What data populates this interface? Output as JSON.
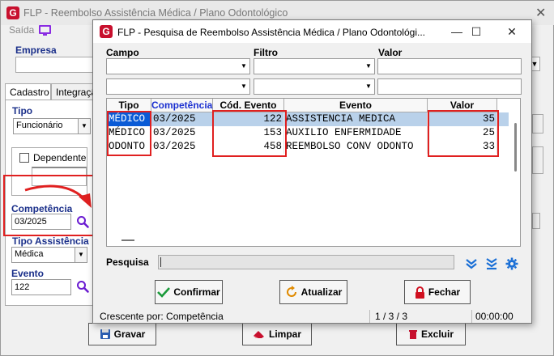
{
  "main": {
    "title": "FLP - Reembolso Assistência Médica / Plano Odontológico",
    "close": "✕",
    "saida": "Saída",
    "empresa_label": "Empresa",
    "tabs": [
      {
        "label": "Cadastro"
      },
      {
        "label": "Integração"
      }
    ],
    "tipo_label": "Tipo",
    "tipo_value": "Funcionário",
    "dependente_label": "Dependente",
    "competencia_label": "Competência",
    "competencia_value": "03/2025",
    "tipo_assistencia_label": "Tipo Assistência",
    "tipo_assistencia_value": "Médica",
    "evento_label": "Evento",
    "evento_value": "122",
    "gravar": "Gravar",
    "limpar": "Limpar",
    "excluir": "Excluir"
  },
  "dialog": {
    "title": "FLP - Pesquisa de Reembolso Assistência Médica / Plano Odontológi...",
    "campo_label": "Campo",
    "filtro_label": "Filtro",
    "valor_label": "Valor",
    "columns": [
      "Tipo",
      "Competência",
      "Cód. Evento",
      "Evento",
      "Valor"
    ],
    "rows": [
      {
        "tipo": "MÉDICO",
        "competencia": "03/2025",
        "cod": "122",
        "evento": "ASSISTENCIA MEDICA",
        "valor": "35"
      },
      {
        "tipo": "MÉDICO",
        "competencia": "03/2025",
        "cod": "153",
        "evento": "AUXILIO ENFERMIDADE",
        "valor": "25"
      },
      {
        "tipo": "ODONTO",
        "competencia": "03/2025",
        "cod": "458",
        "evento": "REEMBOLSO CONV ODONTO",
        "valor": "33"
      }
    ],
    "pesquisa_label": "Pesquisa",
    "confirmar": "Confirmar",
    "atualizar": "Atualizar",
    "fechar": "Fechar",
    "status_sort": "Crescente por: Competência",
    "status_count": "1 / 3 / 3",
    "status_time": "00:00:00"
  },
  "colors": {
    "label_blue": "#1a2f8a",
    "highlight_red": "#e02020",
    "selection": "#b9d1ea",
    "icon_purple": "#6a1bd1",
    "confirm_green": "#1a9a3a",
    "close_red": "#d01020"
  }
}
